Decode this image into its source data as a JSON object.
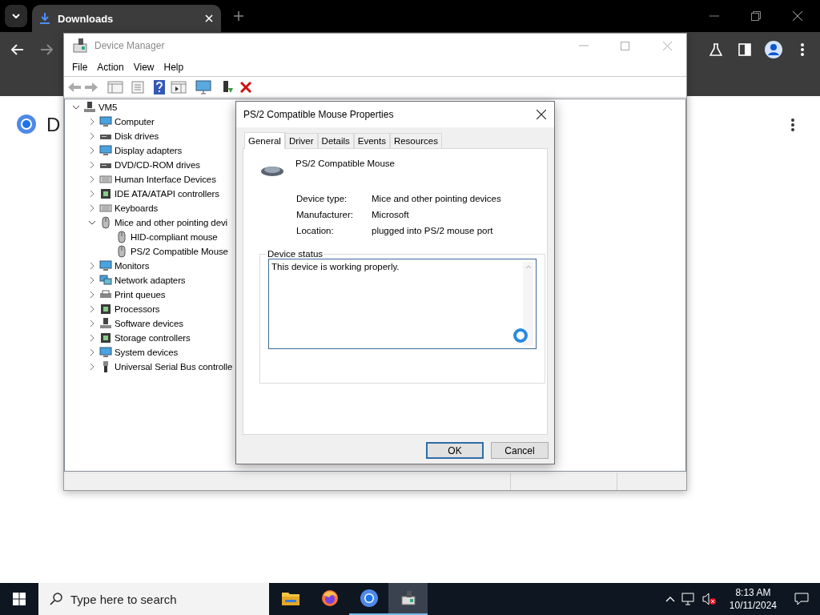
{
  "browser": {
    "tab": {
      "title": "Downloads"
    },
    "page": {
      "heading": "D"
    }
  },
  "device_manager": {
    "title": "Device Manager",
    "menu": [
      "File",
      "Action",
      "View",
      "Help"
    ],
    "tree": {
      "label": "VM5",
      "kind": "computer",
      "expanded": true,
      "children": [
        {
          "label": "Computer",
          "kind": "monitor",
          "expanded": false
        },
        {
          "label": "Disk drives",
          "kind": "drive",
          "expanded": false
        },
        {
          "label": "Display adapters",
          "kind": "monitor",
          "expanded": false
        },
        {
          "label": "DVD/CD-ROM drives",
          "kind": "drive",
          "expanded": false
        },
        {
          "label": "Human Interface Devices",
          "kind": "keyboard",
          "expanded": false
        },
        {
          "label": "IDE ATA/ATAPI controllers",
          "kind": "chip",
          "expanded": false
        },
        {
          "label": "Keyboards",
          "kind": "keyboard",
          "expanded": false
        },
        {
          "label": "Mice and other pointing devi",
          "kind": "mouse",
          "expanded": true,
          "children": [
            {
              "label": "HID-compliant mouse",
              "kind": "mouse"
            },
            {
              "label": "PS/2 Compatible Mouse",
              "kind": "mouse"
            }
          ]
        },
        {
          "label": "Monitors",
          "kind": "monitor",
          "expanded": false
        },
        {
          "label": "Network adapters",
          "kind": "network",
          "expanded": false
        },
        {
          "label": "Print queues",
          "kind": "printer",
          "expanded": false
        },
        {
          "label": "Processors",
          "kind": "chip",
          "expanded": false
        },
        {
          "label": "Software devices",
          "kind": "computer",
          "expanded": false
        },
        {
          "label": "Storage controllers",
          "kind": "chip",
          "expanded": false
        },
        {
          "label": "System devices",
          "kind": "monitor",
          "expanded": false
        },
        {
          "label": "Universal Serial Bus controlle",
          "kind": "usb",
          "expanded": false
        }
      ]
    }
  },
  "dialog": {
    "title": "PS/2 Compatible Mouse Properties",
    "tabs": [
      {
        "label": "General",
        "selected": true
      },
      {
        "label": "Driver",
        "selected": false
      },
      {
        "label": "Details",
        "selected": false
      },
      {
        "label": "Events",
        "selected": false
      },
      {
        "label": "Resources",
        "selected": false
      }
    ],
    "device_name": "PS/2 Compatible Mouse",
    "properties": [
      {
        "label": "Device type:",
        "value": "Mice and other pointing devices"
      },
      {
        "label": "Manufacturer:",
        "value": "Microsoft"
      },
      {
        "label": "Location:",
        "value": "plugged into PS/2 mouse port"
      }
    ],
    "status_group": "Device status",
    "status_text": "This device is working properly.",
    "buttons": [
      {
        "label": "OK",
        "default": true
      },
      {
        "label": "Cancel",
        "default": false
      }
    ]
  },
  "taskbar": {
    "search_placeholder": "Type here to search",
    "apps": [
      {
        "kind": "folder",
        "running": false,
        "selected": false
      },
      {
        "kind": "firefox",
        "running": false,
        "selected": false
      },
      {
        "kind": "chrome",
        "running": true,
        "selected": false
      },
      {
        "kind": "devmgr",
        "running": true,
        "selected": true
      }
    ],
    "time": "8:13 AM",
    "date": "10/11/2024"
  }
}
